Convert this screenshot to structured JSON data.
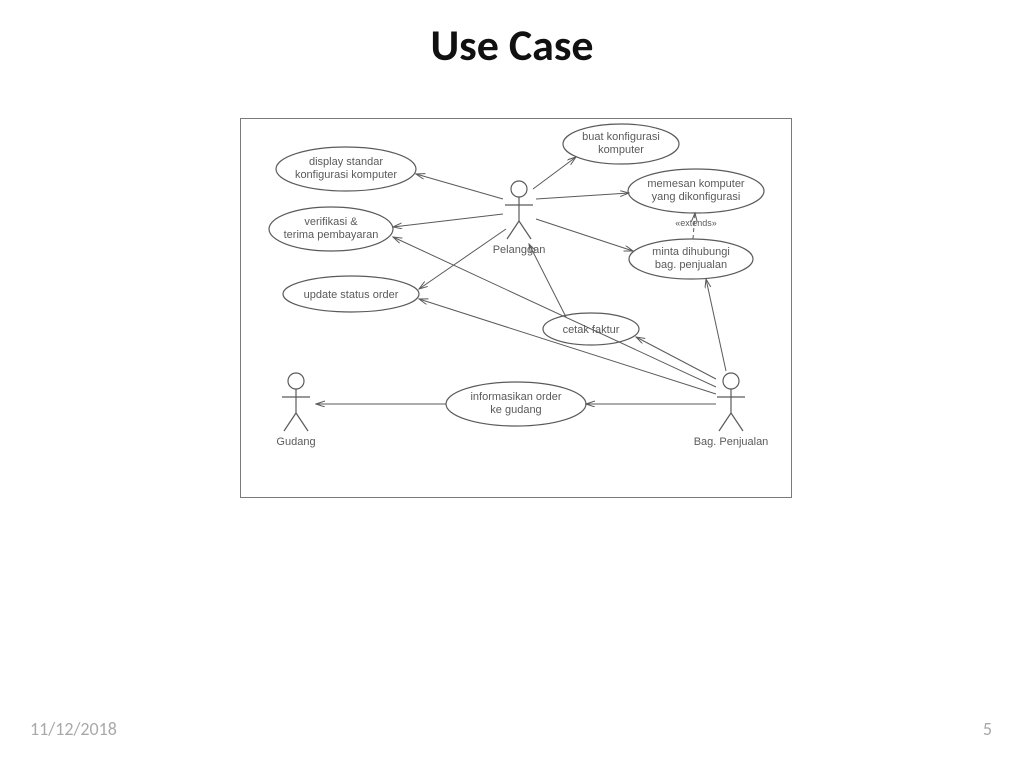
{
  "slide": {
    "title": "Use Case",
    "date": "11/12/2018",
    "page": "5"
  },
  "diagram": {
    "actors": {
      "pelanggan": "Pelanggan",
      "gudang": "Gudang",
      "penjualan": "Bag. Penjualan"
    },
    "usecases": {
      "uc1": {
        "line1": "display standar",
        "line2": "konfigurasi komputer"
      },
      "uc2": {
        "line1": "verifikasi &",
        "line2": "terima pembayaran"
      },
      "uc3": {
        "line1": "update status order"
      },
      "uc4": {
        "line1": "buat konfigurasi",
        "line2": "komputer"
      },
      "uc5": {
        "line1": "memesan komputer",
        "line2": "yang dikonfigurasi"
      },
      "uc6": {
        "line1": "minta dihubungi",
        "line2": "bag. penjualan"
      },
      "uc7": {
        "line1": "cetak faktur"
      },
      "uc8": {
        "line1": "informasikan order",
        "line2": "ke gudang"
      }
    },
    "extend_stereotype": "«extends»"
  }
}
